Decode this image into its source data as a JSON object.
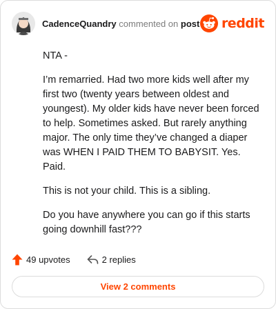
{
  "header": {
    "username": "CadenceQuandry",
    "action_text": " commented on ",
    "post_label": "post",
    "brand": "reddit"
  },
  "comment": {
    "paragraphs": [
      "NTA -",
      "I’m remarried. Had two more kids well after my first two (twenty years between oldest and youngest). My older kids have never been forced to help. Sometimes asked. But rarely anything major. The only time they’ve changed a diaper was WHEN I PAID THEM TO BABYSIT. Yes. Paid.",
      "This is not your child. This is a sibling.",
      "Do you have anywhere you can go if this starts going downhill fast???"
    ]
  },
  "actions": {
    "upvotes": "49 upvotes",
    "replies": "2 replies"
  },
  "footer": {
    "view_comments": "View 2 comments"
  },
  "icons": {
    "avatar": "avatar-icon",
    "brand_logo": "reddit-logo-icon",
    "upvote": "upvote-arrow-icon",
    "reply": "reply-arrow-icon"
  },
  "colors": {
    "brand": "#ff4500",
    "text": "#1a1a1b",
    "muted": "#7c7c7c",
    "border": "#dcdcdc"
  }
}
